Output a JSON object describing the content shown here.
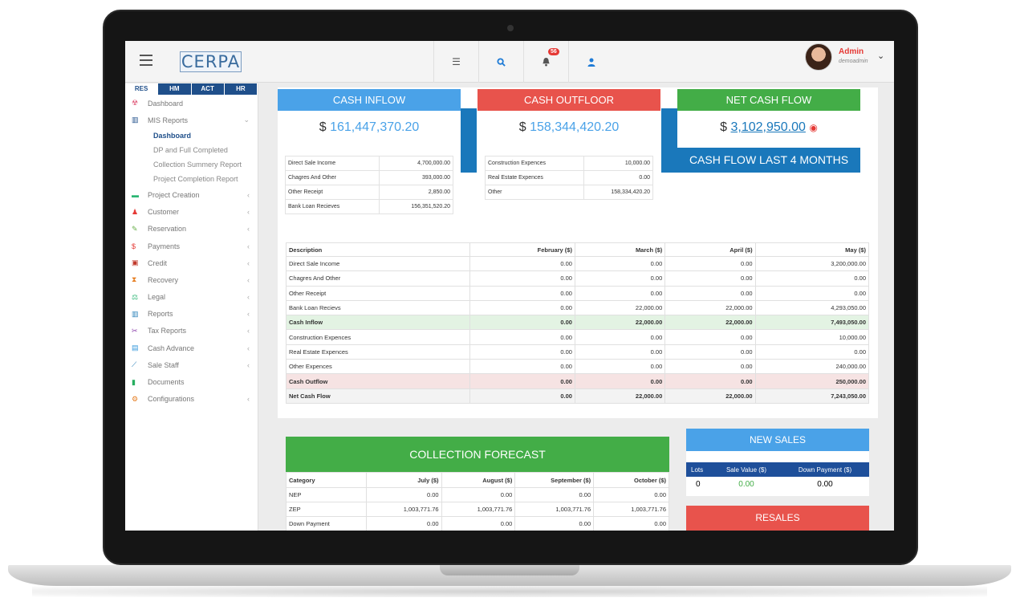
{
  "header": {
    "logo": "CERPA",
    "notification_count": "56",
    "user_name": "Admin",
    "user_sub": "demoadmin"
  },
  "sidebar": {
    "module_tabs": [
      "RES",
      "HM",
      "ACT",
      "HR"
    ],
    "items": [
      {
        "label": "Dashboard",
        "icon": "dashboard-icon",
        "color": "#e05a7a",
        "arrow": ""
      },
      {
        "label": "MIS Reports",
        "icon": "bar-chart-icon",
        "color": "#1f4f8a",
        "arrow": "⌄"
      },
      {
        "label": "Project Creation",
        "icon": "project-icon",
        "color": "#2bb673",
        "arrow": "‹"
      },
      {
        "label": "Customer",
        "icon": "customer-icon",
        "color": "#e53935",
        "arrow": "‹"
      },
      {
        "label": "Reservation",
        "icon": "edit-icon",
        "color": "#6ab04c",
        "arrow": "‹"
      },
      {
        "label": "Payments",
        "icon": "dollar-icon",
        "color": "#e53935",
        "arrow": "‹"
      },
      {
        "label": "Credit",
        "icon": "credit-icon",
        "color": "#c0392b",
        "arrow": "‹"
      },
      {
        "label": "Recovery",
        "icon": "hourglass-icon",
        "color": "#e67e22",
        "arrow": "‹"
      },
      {
        "label": "Legal",
        "icon": "scale-icon",
        "color": "#2bb673",
        "arrow": "‹"
      },
      {
        "label": "Reports",
        "icon": "report-icon",
        "color": "#2980b9",
        "arrow": "‹"
      },
      {
        "label": "Tax Reports",
        "icon": "scissors-icon",
        "color": "#8e44ad",
        "arrow": "‹"
      },
      {
        "label": "Cash Advance",
        "icon": "document-icon",
        "color": "#3498db",
        "arrow": "‹"
      },
      {
        "label": "Sale Staff",
        "icon": "line-chart-icon",
        "color": "#2980b9",
        "arrow": "‹"
      },
      {
        "label": "Documents",
        "icon": "file-icon",
        "color": "#27ae60",
        "arrow": ""
      },
      {
        "label": "Configurations",
        "icon": "cogs-icon",
        "color": "#e67e22",
        "arrow": "‹"
      }
    ],
    "mis_sub": [
      "Dashboard",
      "DP and Full Completed",
      "Collection Summery Report",
      "Project Completion Report"
    ]
  },
  "colors": {
    "inflow": "#4aa2e8",
    "outfloor": "#e8534c",
    "net": "#43ad47",
    "accent": "#1a78bb"
  },
  "cards": {
    "inflow": {
      "title": "CASH INFLOW",
      "amount": "$ 161,447,370.20",
      "rows": [
        [
          "Direct Sale Income",
          "4,700,000.00"
        ],
        [
          "Chagres And Other",
          "393,000.00"
        ],
        [
          "Other Receipt",
          "2,850.00"
        ],
        [
          "Bank Loan Recieves",
          "156,351,520.20"
        ]
      ]
    },
    "outfloor": {
      "title": "CASH OUTFLOOR",
      "amount": "$ 158,344,420.20",
      "rows": [
        [
          "Construction Expences",
          "10,000.00"
        ],
        [
          "Real Estate Expences",
          "0.00"
        ],
        [
          "Other",
          "158,334,420.20"
        ]
      ]
    },
    "net": {
      "title": "NET CASH FLOW",
      "currency": "$",
      "amount": "3,102,950.00",
      "last4": "CASH FLOW LAST 4 MONTHS"
    }
  },
  "monthly": {
    "headers": [
      "Description",
      "February ($)",
      "March ($)",
      "April ($)",
      "May ($)"
    ],
    "rows": [
      {
        "type": "normal",
        "cells": [
          "Direct Sale Income",
          "0.00",
          "0.00",
          "0.00",
          "3,200,000.00"
        ]
      },
      {
        "type": "normal",
        "cells": [
          "Chagres And Other",
          "0.00",
          "0.00",
          "0.00",
          "0.00"
        ]
      },
      {
        "type": "normal",
        "cells": [
          "Other Receipt",
          "0.00",
          "0.00",
          "0.00",
          "0.00"
        ]
      },
      {
        "type": "normal",
        "cells": [
          "Bank Loan Recievs",
          "0.00",
          "22,000.00",
          "22,000.00",
          "4,293,050.00"
        ]
      },
      {
        "type": "in",
        "cells": [
          "Cash Inflow",
          "0.00",
          "22,000.00",
          "22,000.00",
          "7,493,050.00"
        ]
      },
      {
        "type": "normal",
        "cells": [
          "Construction Expences",
          "0.00",
          "0.00",
          "0.00",
          "10,000.00"
        ]
      },
      {
        "type": "normal",
        "cells": [
          "Real Estate Expences",
          "0.00",
          "0.00",
          "0.00",
          "0.00"
        ]
      },
      {
        "type": "normal",
        "cells": [
          "Other Expences",
          "0.00",
          "0.00",
          "0.00",
          "240,000.00"
        ]
      },
      {
        "type": "out",
        "cells": [
          "Cash Outflow",
          "0.00",
          "0.00",
          "0.00",
          "250,000.00"
        ]
      },
      {
        "type": "net",
        "cells": [
          "Net Cash Flow",
          "0.00",
          "22,000.00",
          "22,000.00",
          "7,243,050.00"
        ]
      }
    ]
  },
  "collection": {
    "title": "COLLECTION FORECAST",
    "headers": [
      "Category",
      "July ($)",
      "August ($)",
      "September ($)",
      "October ($)"
    ],
    "rows": [
      [
        "NEP",
        "0.00",
        "0.00",
        "0.00",
        "0.00"
      ],
      [
        "ZEP",
        "1,003,771.76",
        "1,003,771.76",
        "1,003,771.76",
        "1,003,771.76"
      ],
      [
        "Down Payment",
        "0.00",
        "0.00",
        "0.00",
        "0.00"
      ]
    ]
  },
  "new_sales": {
    "title": "NEW SALES",
    "cols": [
      "Lots",
      "Sale Value ($)",
      "Down Payment ($)"
    ],
    "vals": [
      "0",
      "0.00",
      "0.00"
    ]
  },
  "resales": {
    "title": "RESALES"
  }
}
